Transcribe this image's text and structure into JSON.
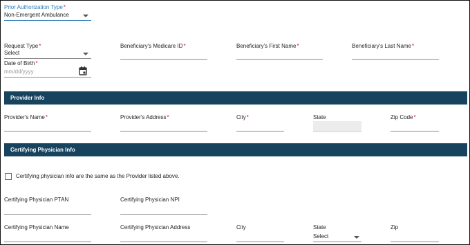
{
  "prior_auth": {
    "label": "Prior Authorization Type",
    "value": "Non-Emergent Ambulance"
  },
  "request_type": {
    "label": "Request Type",
    "value": "Select"
  },
  "medicare_id": {
    "label": "Beneficiary's Medicare ID"
  },
  "first_name": {
    "label": "Beneficiary's First Name"
  },
  "last_name": {
    "label": "Beneficiary's Last Name"
  },
  "dob": {
    "label": "Date of Birth",
    "placeholder": "mm/dd/yyyy"
  },
  "provider_info": {
    "title": "Provider Info",
    "name_label": "Provider's Name",
    "address_label": "Provider's Address",
    "city_label": "City",
    "state_label": "State",
    "zip_label": "Zip Code"
  },
  "certifying": {
    "title": "Certifying Physician Info",
    "same_as_label": "Certifying physician info are the same as the Provider listed above.",
    "ptan_label": "Certifying Physician PTAN",
    "npi_label": "Certifying Physician NPI",
    "name_label": "Certifying Physician Name",
    "address_label": "Certifying Physician Address",
    "city_label": "City",
    "state_label": "State",
    "state_value": "Select",
    "zip_label": "Zip"
  },
  "colors": {
    "section_bar": "#17435e",
    "required": "#e0001b",
    "focus": "#2a7ab8"
  },
  "icons": {
    "dropdown": "caret-down-icon",
    "calendar": "calendar-icon"
  }
}
